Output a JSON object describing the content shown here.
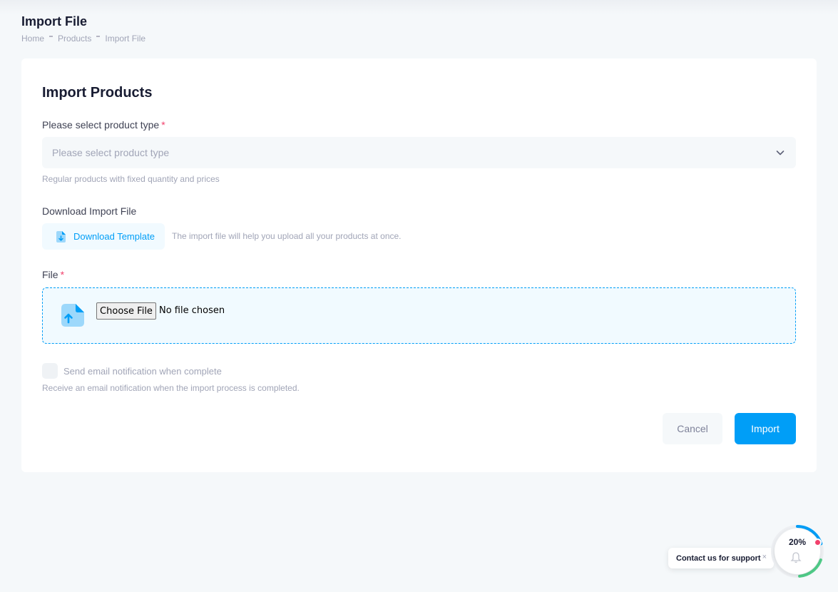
{
  "header": {
    "title": "Import File",
    "breadcrumb": [
      "Home",
      "Products",
      "Import File"
    ]
  },
  "card": {
    "title": "Import Products",
    "product_type": {
      "label": "Please select product type",
      "placeholder": "Please select product type",
      "hint": "Regular products with fixed quantity and prices"
    },
    "download": {
      "label": "Download Import File",
      "button": "Download Template",
      "hint": "The import file will help you upload all your products at once."
    },
    "file": {
      "label": "File",
      "choose_button": "Choose File",
      "status": "No file chosen"
    },
    "notification": {
      "label": "Send email notification when complete",
      "hint": "Receive an email notification when the import process is completed."
    },
    "actions": {
      "cancel": "Cancel",
      "import": "Import"
    }
  },
  "support": {
    "text": "Contact us for support",
    "close": "×",
    "progress_text": "20%",
    "progress": 0.2
  },
  "colors": {
    "primary": "#009ef7",
    "danger": "#f1416c",
    "success": "#50cd89"
  }
}
